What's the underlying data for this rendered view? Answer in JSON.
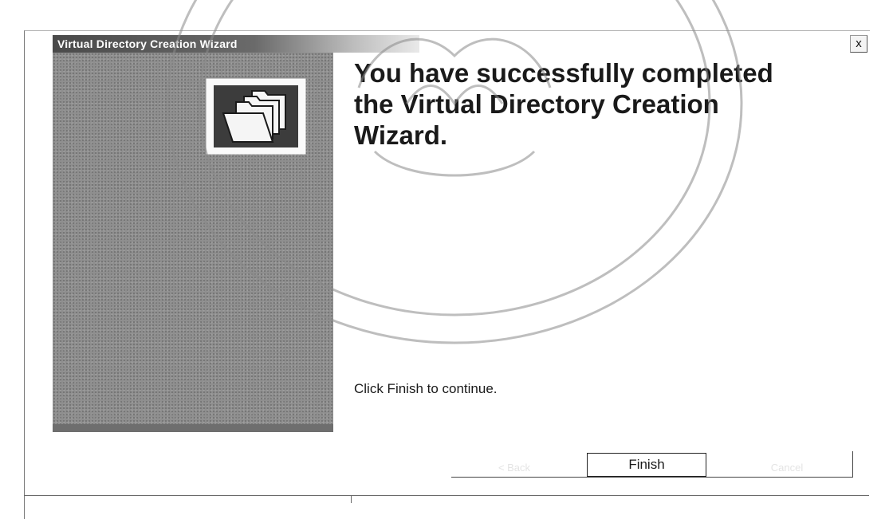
{
  "window": {
    "title": "Virtual Directory Creation Wizard",
    "close_label": "x"
  },
  "content": {
    "heading": "You have successfully completed the Virtual Directory Creation Wizard.",
    "instruction": "Click Finish to continue."
  },
  "buttons": {
    "back_label": "< Back",
    "finish_label": "Finish",
    "cancel_label": "Cancel"
  },
  "icons": {
    "wizard_image": "folders-icon",
    "close": "close-icon"
  }
}
